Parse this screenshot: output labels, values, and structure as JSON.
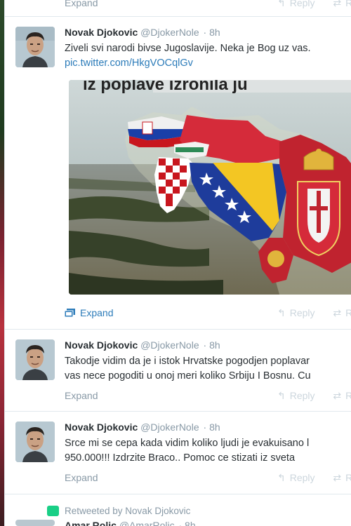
{
  "top_partial": {
    "expand_label": "Expand",
    "reply_label": "Reply",
    "retweet_label": "R"
  },
  "tweets": [
    {
      "name": "Novak Djokovic",
      "handle": "@DjokerNole",
      "time": "8h",
      "text_line1": "Ziveli svi narodi bivse Jugoslavije. Neka je Bog uz vas.",
      "link": "pic.twitter.com/HkgVOCqlGv",
      "media_caption": "iz poplave izronila ju",
      "expand_label": "Expand",
      "reply_label": "Reply",
      "retweet_label": "R"
    },
    {
      "name": "Novak Djokovic",
      "handle": "@DjokerNole",
      "time": "8h",
      "text_line1": "Takodje vidim da je i istok Hrvatske pogodjen poplavar",
      "text_line2": "vas nece pogoditi u onoj meri koliko Srbiju I Bosnu. Cu",
      "expand_label": "Expand",
      "reply_label": "Reply",
      "retweet_label": "R"
    },
    {
      "name": "Novak Djokovic",
      "handle": "@DjokerNole",
      "time": "8h",
      "text_line1": "Srce mi se cepa kada vidim koliko ljudi je evakuisano l",
      "text_line2": "950.000!!! Izdrzite Braco.. Pomoc ce stizati iz sveta",
      "expand_label": "Expand",
      "reply_label": "Reply",
      "retweet_label": "R"
    }
  ],
  "retweet_notice": {
    "label": "Retweeted by Novak Djokovic",
    "next_name": "Amar Rolic",
    "next_handle": "@AmarRolic",
    "next_time": "8h"
  },
  "colors": {
    "link": "#2b7bb9",
    "muted": "#8899a6",
    "text": "#292f33",
    "retweet_green": "#19cf86"
  },
  "icons": {
    "expand": "photo-icon",
    "reply": "reply-icon",
    "retweet": "retweet-icon"
  }
}
